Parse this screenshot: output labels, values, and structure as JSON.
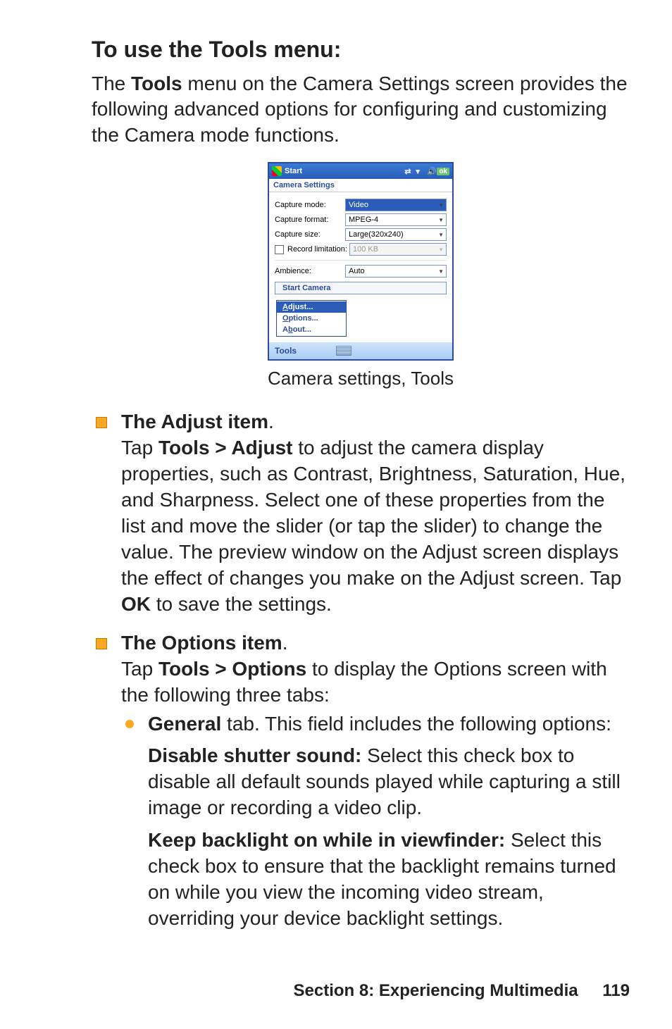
{
  "heading": "To use the Tools menu:",
  "intro": {
    "pre": "The ",
    "bold": "Tools",
    "post": " menu on the Camera Settings screen provides the following advanced options for configuring and customizing the Camera mode functions."
  },
  "screenshot": {
    "titlebar": {
      "start": "Start",
      "ok": "ok"
    },
    "header": "Camera Settings",
    "rows": {
      "capture_mode": {
        "label": "Capture mode:",
        "value": "Video"
      },
      "capture_format": {
        "label": "Capture format:",
        "value": "MPEG-4"
      },
      "capture_size": {
        "label": "Capture size:",
        "value": "Large(320x240)"
      },
      "record_limit": {
        "label": "Record limitation:",
        "value": "100 KB"
      },
      "ambience": {
        "label": "Ambience:",
        "value": "Auto"
      }
    },
    "start_button": "Start Camera",
    "menu": {
      "adjust": {
        "ul": "A",
        "rest": "djust..."
      },
      "options": {
        "ul": "O",
        "rest": "ptions..."
      },
      "about": {
        "pre": "A",
        "ul": "b",
        "rest": "out..."
      }
    },
    "bottombar": {
      "tools": "Tools"
    }
  },
  "caption": "Camera settings, Tools",
  "bullets": {
    "adjust": {
      "title": "The Adjust item",
      "dot": ".",
      "tap_pre": "Tap ",
      "tap_bold": "Tools > Adjust",
      "tap_mid": " to adjust the camera display properties, such as Contrast, Brightness, Saturation, Hue, and Sharpness. Select one of these properties from the list and move the slider (or tap the slider) to change the value. The preview window on the Adjust screen displays the effect of changes you make on the Adjust screen. Tap ",
      "ok_bold": "OK",
      "tap_post": " to save the settings."
    },
    "options": {
      "title": "The Options item",
      "dot": ".",
      "tap_pre": "Tap ",
      "tap_bold": "Tools > Options",
      "tap_post": " to display the Options screen with the following three tabs:"
    }
  },
  "sub": {
    "general": {
      "bold": "General",
      "post": " tab. This field includes the following options:",
      "disable": {
        "bold": "Disable shutter sound:",
        "post": " Select this check box to disable all default sounds played while capturing a still image or recording a video clip."
      },
      "keep": {
        "bold": "Keep backlight on while in viewfinder:",
        "post": " Select this check box to ensure that the backlight remains turned on while you view the incoming video stream, overriding your device backlight settings."
      }
    }
  },
  "footer": {
    "section": "Section 8: Experiencing Multimedia",
    "page": "119"
  }
}
